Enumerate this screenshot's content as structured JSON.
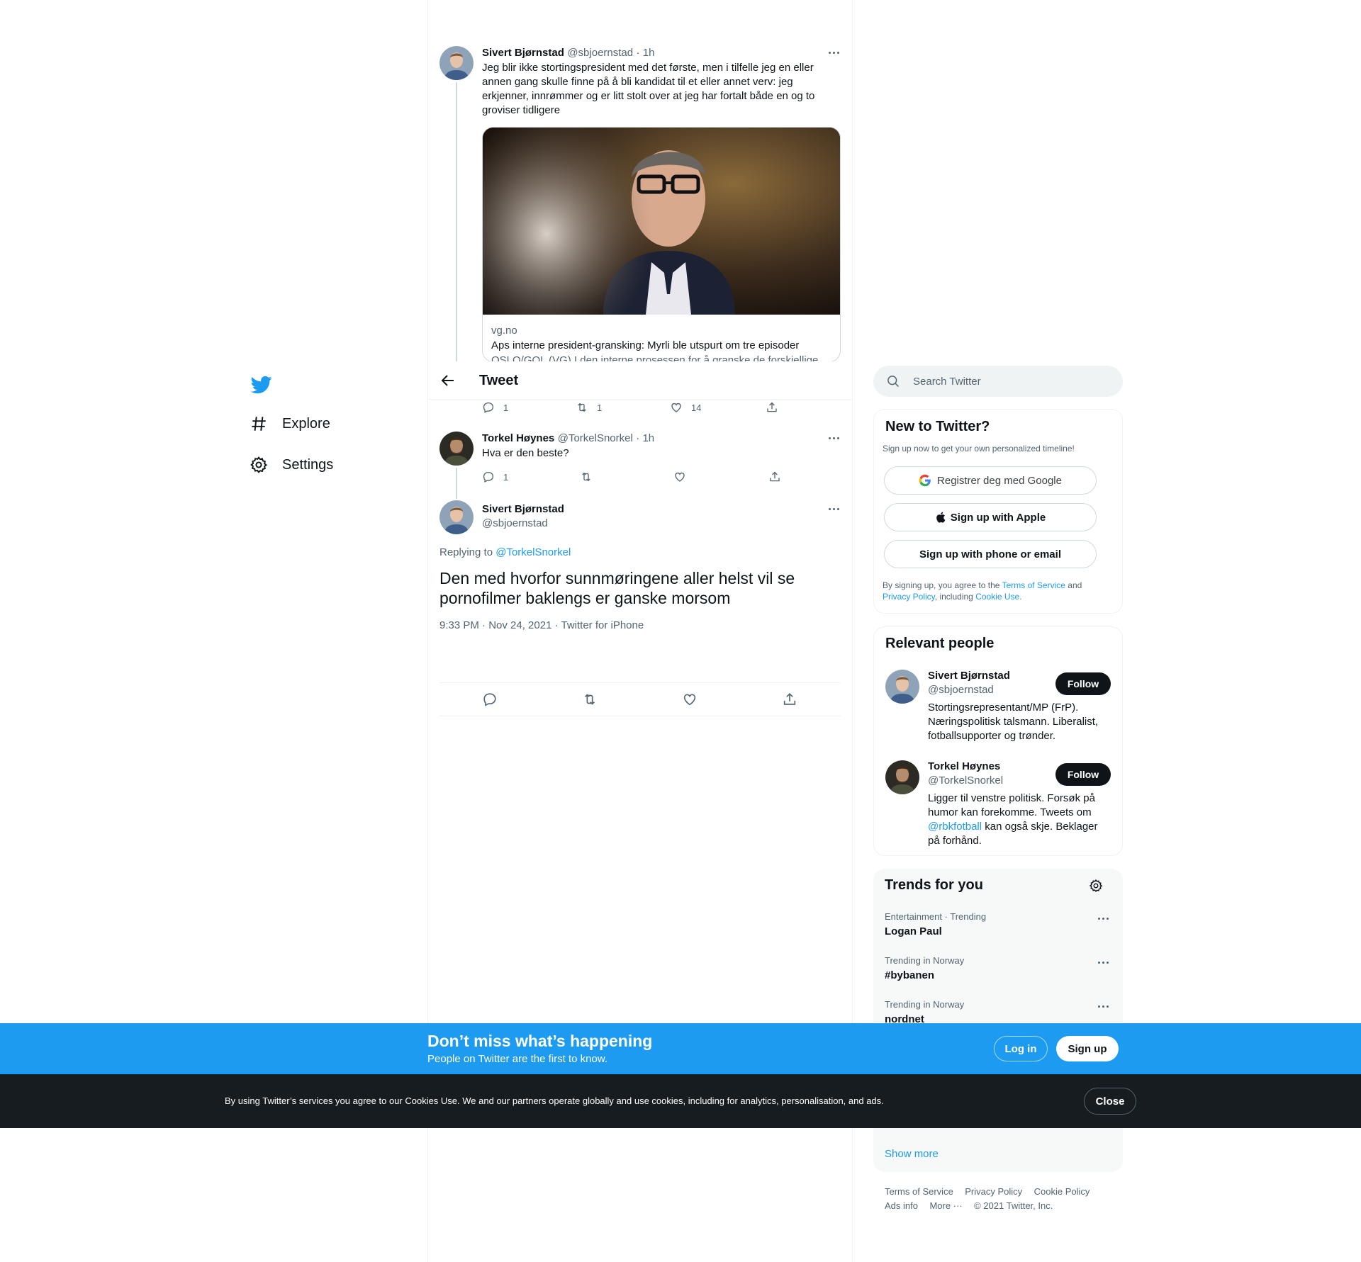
{
  "nav": {
    "explore_label": "Explore",
    "settings_label": "Settings"
  },
  "header": {
    "title": "Tweet"
  },
  "thread": {
    "tweet1": {
      "name": "Sivert Bjørnstad",
      "handle": "@sbjoernstad",
      "time": "· 1h",
      "text": "Jeg blir ikke stortingspresident med det første, men i tilfelle jeg en eller annen gang skulle finne på å bli kandidat til et eller annet verv: jeg erkjenner, innrømmer og er litt stolt over at jeg har fortalt både en og to groviser tidligere",
      "card_domain": "vg.no",
      "card_title": "Aps interne president-gransking: Myrli ble utspurt om tre episoder",
      "card_desc": "OSLO/GOL (VG) I den interne prosessen for å granske de forskjellige",
      "replies": "1",
      "retweets": "1",
      "likes": "14"
    },
    "tweet2": {
      "name": "Torkel Høynes",
      "handle": "@TorkelSnorkel",
      "time": "· 1h",
      "text": "Hva er den beste?",
      "replies": "1"
    },
    "main": {
      "name": "Sivert Bjørnstad",
      "handle": "@sbjoernstad",
      "replying_prefix": "Replying to",
      "replying_to": "@TorkelSnorkel",
      "text": "Den med hvorfor sunnmøringene aller helst vil se pornofilmer baklengs er ganske morsom",
      "timestamp": "9:33 PM · Nov 24, 2021 · Twitter for iPhone"
    }
  },
  "search": {
    "placeholder": "Search Twitter"
  },
  "signup_panel": {
    "title": "New to Twitter?",
    "subtitle": "Sign up now to get your own personalized timeline!",
    "google_label": "Registrer deg med Google",
    "apple_label": "Sign up with Apple",
    "phone_label": "Sign up with phone or email",
    "legal_1": "By signing up, you agree to the",
    "terms": "Terms of Service",
    "legal_2": "and",
    "privacy": "Privacy Policy",
    "legal_3": ", including",
    "cookie": "Cookie Use",
    "legal_4": "."
  },
  "relevant": {
    "title": "Relevant people",
    "people": [
      {
        "name": "Sivert Bjørnstad",
        "handle": "@sbjoernstad",
        "follow": "Follow",
        "bio": "Stortingsrepresentant/MP (FrP). Næringspolitisk talsmann. Liberalist, fotballsupporter og trønder."
      },
      {
        "name": "Torkel Høynes",
        "handle": "@TorkelSnorkel",
        "follow": "Follow",
        "bio_1": "Ligger til venstre politisk. Forsøk på humor kan forekomme. Tweets om",
        "bio_link": "@rbkfotball",
        "bio_2": "kan også skje. Beklager på forhånd."
      }
    ]
  },
  "trends": {
    "title": "Trends for you",
    "items": [
      {
        "meta": "Entertainment · Trending",
        "name": "Logan Paul"
      },
      {
        "meta": "Trending in Norway",
        "name": "#bybanen"
      },
      {
        "meta": "Trending in Norway",
        "name": "nordnet"
      }
    ],
    "show_more": "Show more"
  },
  "footer": {
    "links": [
      "Terms of Service",
      "Privacy Policy",
      "Cookie Policy",
      "Ads info",
      "More ···"
    ],
    "copyright": "© 2021 Twitter, Inc."
  },
  "promo": {
    "headline": "Don’t miss what’s happening",
    "subline": "People on Twitter are the first to know.",
    "login": "Log in",
    "signup": "Sign up"
  },
  "cookie_bar": {
    "text": "By using Twitter’s services you agree to our Cookies Use. We and our partners operate globally and use cookies, including for analytics, personalisation, and ads.",
    "close": "Close"
  },
  "colors": {
    "accent": "#1d9bf0",
    "text": "#0f1419",
    "secondary": "#536471",
    "cookie_bg": "#161c20"
  }
}
